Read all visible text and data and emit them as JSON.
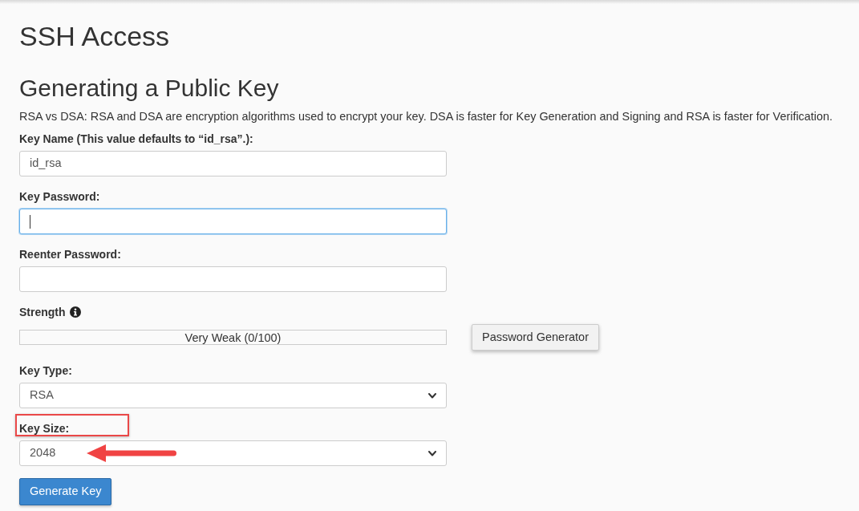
{
  "page_title": "SSH Access",
  "section": {
    "title": "Generating a Public Key",
    "description": "RSA vs DSA: RSA and DSA are encryption algorithms used to encrypt your key. DSA is faster for Key Generation and Signing and RSA is faster for Verification."
  },
  "fields": [
    {
      "kind": "text",
      "label": "Key Name (This value defaults to “id_rsa”.):",
      "value": "id_rsa",
      "focused": false,
      "highlighted": false,
      "pointed": false
    },
    {
      "kind": "password",
      "label": "Key Password:",
      "focused": true,
      "highlighted": false,
      "pointed": false
    },
    {
      "kind": "password",
      "label": "Reenter Password:",
      "focused": false,
      "highlighted": false,
      "pointed": false
    },
    {
      "kind": "strength",
      "label": "Strength",
      "level": 0,
      "reading": "Very Weak (0/100)",
      "button": "Password Generator",
      "focused": false,
      "highlighted": false,
      "pointed": false
    },
    {
      "kind": "select",
      "label": "Key Type:",
      "value": "RSA",
      "focused": false,
      "highlighted": false,
      "pointed": false
    },
    {
      "kind": "select",
      "label": "Key Size:",
      "value": "2048",
      "focused": false,
      "highlighted": true,
      "pointed": true
    }
  ],
  "submit": "Generate Key"
}
